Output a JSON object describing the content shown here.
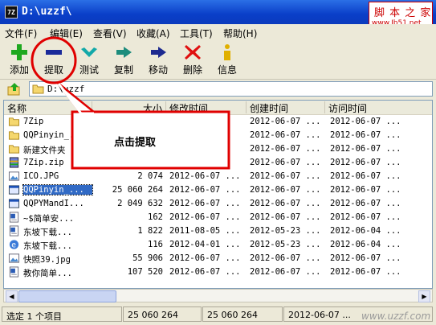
{
  "titlebar": {
    "title": "D:\\uzzf\\",
    "app_icon": "7Z"
  },
  "watermark": {
    "top": "脚 本 之 家",
    "url": "www.Jb51.net"
  },
  "menu": [
    "文件(F)",
    "编辑(E)",
    "查看(V)",
    "收藏(A)",
    "工具(T)",
    "帮助(H)"
  ],
  "toolbar": [
    {
      "label": "添加",
      "icon": "plus-icon",
      "color": "#1fa81f"
    },
    {
      "label": "提取",
      "icon": "minus-icon",
      "color": "#1a2a9a"
    },
    {
      "label": "测试",
      "icon": "check-icon",
      "color": "#13a9a9"
    },
    {
      "label": "复制",
      "icon": "copy-arrow-icon",
      "color": "#1c8c7c"
    },
    {
      "label": "移动",
      "icon": "move-arrow-icon",
      "color": "#1d2a8f"
    },
    {
      "label": "删除",
      "icon": "delete-x-icon",
      "color": "#e01010"
    },
    {
      "label": "信息",
      "icon": "info-icon",
      "color": "#e0b000"
    }
  ],
  "address": {
    "value": "D:\\uzzf"
  },
  "columns": [
    "名称",
    "大小",
    "修改时间",
    "创建时间",
    "访问时间"
  ],
  "files": [
    {
      "name": "7Zip",
      "size": "",
      "modified": "",
      "created": "2012-06-07 ...",
      "accessed": "2012-06-07 ...",
      "type": "folder"
    },
    {
      "name": "QQPinyin_...",
      "size": "",
      "modified": "",
      "created": "2012-06-07 ...",
      "accessed": "2012-06-07 ...",
      "type": "folder"
    },
    {
      "name": "新建文件夹",
      "size": "",
      "modified": "",
      "created": "2012-06-07 ...",
      "accessed": "2012-06-07 ...",
      "type": "folder"
    },
    {
      "name": "7Zip.zip",
      "size": "",
      "modified": "",
      "created": "2012-06-07 ...",
      "accessed": "2012-06-07 ...",
      "type": "archive"
    },
    {
      "name": "ICO.JPG",
      "size": "2 074",
      "modified": "2012-06-07 ...",
      "created": "2012-06-07 ...",
      "accessed": "2012-06-07 ...",
      "type": "image"
    },
    {
      "name": "QQPinyin_...",
      "size": "25 060 264",
      "modified": "2012-06-07 ...",
      "created": "2012-06-07 ...",
      "accessed": "2012-06-07 ...",
      "type": "exe",
      "selected": true
    },
    {
      "name": "QQPYMandI...",
      "size": "2 049 632",
      "modified": "2012-06-07 ...",
      "created": "2012-06-07 ...",
      "accessed": "2012-06-07 ...",
      "type": "exe"
    },
    {
      "name": "~$简单安...",
      "size": "162",
      "modified": "2012-06-07 ...",
      "created": "2012-06-07 ...",
      "accessed": "2012-06-07 ...",
      "type": "doc"
    },
    {
      "name": "东坡下载...",
      "size": "1 822",
      "modified": "2011-08-05 ...",
      "created": "2012-05-23 ...",
      "accessed": "2012-06-04 ...",
      "type": "doc"
    },
    {
      "name": "东坡下载...",
      "size": "116",
      "modified": "2012-04-01 ...",
      "created": "2012-05-23 ...",
      "accessed": "2012-06-04 ...",
      "type": "ie"
    },
    {
      "name": "快照39.jpg",
      "size": "55 906",
      "modified": "2012-06-07 ...",
      "created": "2012-06-07 ...",
      "accessed": "2012-06-07 ...",
      "type": "image"
    },
    {
      "name": "教你简单...",
      "size": "107 520",
      "modified": "2012-06-07 ...",
      "created": "2012-06-07 ...",
      "accessed": "2012-06-07 ...",
      "type": "doc"
    }
  ],
  "status": {
    "selected": "选定 1 个项目",
    "size": "25 060 264",
    "packed": "25 060 264",
    "date": "2012-06-07 ..."
  },
  "callout": {
    "text": "点击提取",
    "accent": "#e00000"
  },
  "bottom_watermark": "www.uzzf.com"
}
